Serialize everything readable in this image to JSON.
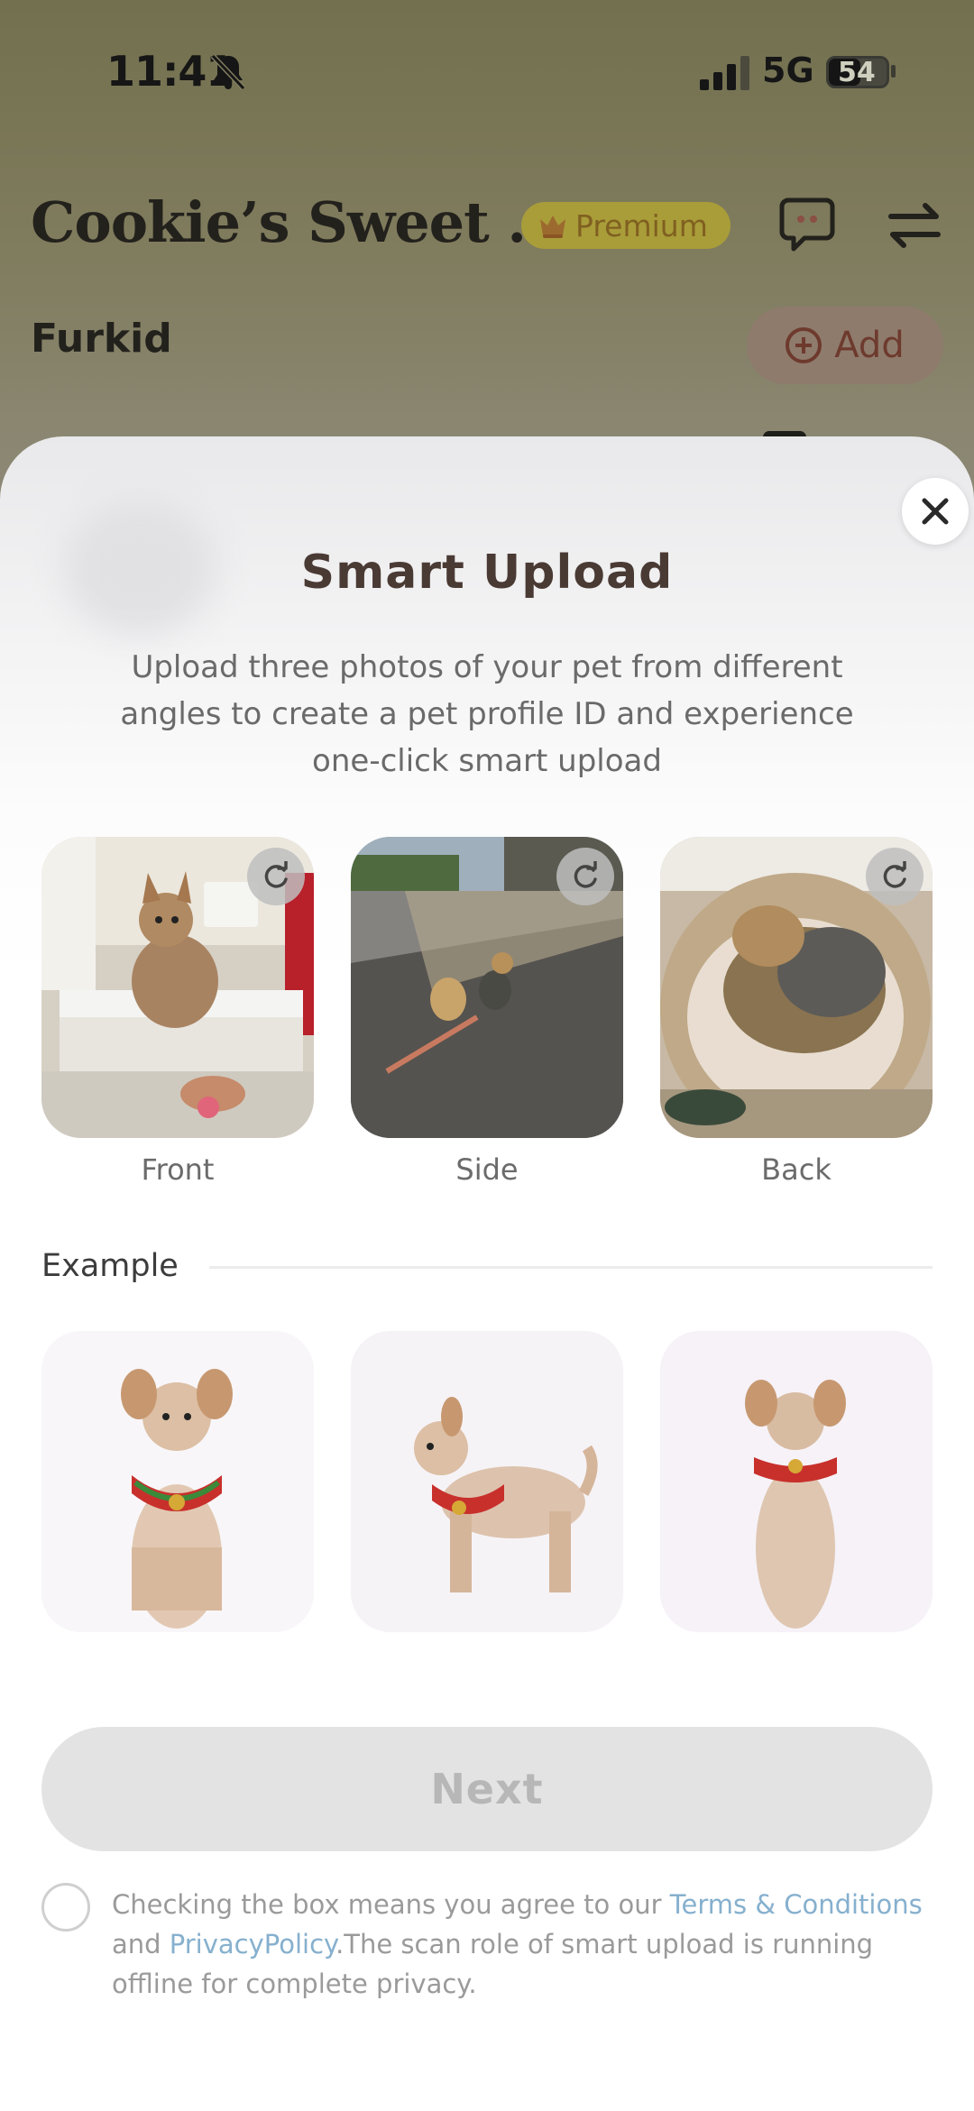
{
  "status_bar": {
    "time": "11:41",
    "network": "5G",
    "battery": "54",
    "battery_level": 0.54
  },
  "header": {
    "app_title": "Cookie’s Sweet ...",
    "premium_label": "Premium",
    "chat_icon": "chat-bubble-icon",
    "switch_icon": "swap-arrows-icon"
  },
  "section": {
    "title": "Furkid",
    "add_label": "Add"
  },
  "sheet": {
    "title": "Smart Upload",
    "description": "Upload three photos of your pet from different angles to create a pet profile ID and experience one-click smart upload",
    "photos": [
      {
        "label": "Front",
        "icon": "refresh-icon"
      },
      {
        "label": "Side",
        "icon": "refresh-icon"
      },
      {
        "label": "Back",
        "icon": "refresh-icon"
      }
    ],
    "example_label": "Example",
    "next_label": "Next",
    "agreement": {
      "prefix": "Checking the box means you agree to our ",
      "terms_link": "Terms & Conditions",
      "middle": "and ",
      "privacy_link": "PrivacyPolicy",
      "suffix": ".The scan role of smart upload is running offline for complete privacy."
    }
  },
  "colors": {
    "title_brown": "#4a3a34",
    "link_blue": "#86b0ce",
    "disabled_button": "#e3e3e3"
  }
}
